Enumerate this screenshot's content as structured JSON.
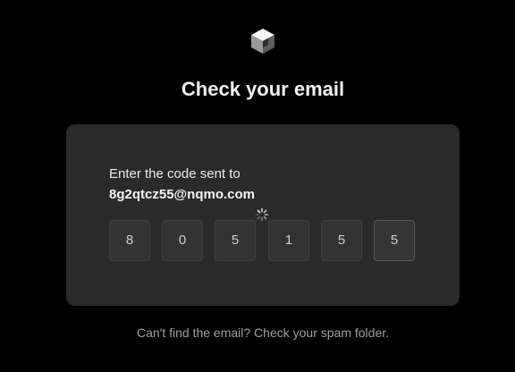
{
  "header": {
    "logo_icon": "cube-logo-icon",
    "title": "Check your email"
  },
  "verification": {
    "prompt": "Enter the code sent to",
    "email": "8g2qtcz55@nqmo.com",
    "spinner_icon": "loading-spinner-icon",
    "digits": [
      "8",
      "0",
      "5",
      "1",
      "5",
      "5"
    ]
  },
  "footer": {
    "hint": "Can't find the email? Check your spam folder."
  },
  "colors": {
    "background": "#000000",
    "card": "#2a2a2a",
    "digit_box": "#333333"
  }
}
